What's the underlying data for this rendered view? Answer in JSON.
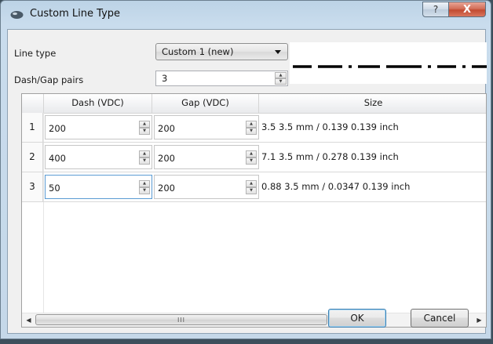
{
  "window": {
    "title": "Custom Line Type",
    "help_glyph": "?",
    "close_glyph": "X"
  },
  "form": {
    "line_type_label": "Line type",
    "line_type_value": "Custom 1 (new)",
    "dash_gap_label": "Dash/Gap pairs",
    "dash_gap_value": "3"
  },
  "table": {
    "columns": [
      "Dash (VDC)",
      "Gap (VDC)",
      "Size"
    ],
    "rows": [
      {
        "num": "1",
        "dash": "200",
        "gap": "200",
        "size": "3.5 3.5 mm / 0.139 0.139 inch"
      },
      {
        "num": "2",
        "dash": "400",
        "gap": "200",
        "size": "7.1 3.5 mm / 0.278 0.139 inch"
      },
      {
        "num": "3",
        "dash": "50",
        "gap": "200",
        "size": "0.88 3.5 mm / 0.0347 0.139 inch"
      }
    ],
    "scroll_grip": "III"
  },
  "buttons": {
    "ok": "OK",
    "cancel": "Cancel"
  },
  "icons": {
    "app": "line-type-icon",
    "help": "help-icon",
    "close": "close-icon",
    "spin_up": "spin-up-icon",
    "spin_down": "spin-down-icon",
    "dropdown": "chevron-down-icon",
    "scroll_left": "scroll-left-icon",
    "scroll_right": "scroll-right-icon"
  },
  "colors": {
    "accent": "#3c7fb1",
    "close_red": "#c24a31",
    "frame": "#c5d8e9"
  }
}
